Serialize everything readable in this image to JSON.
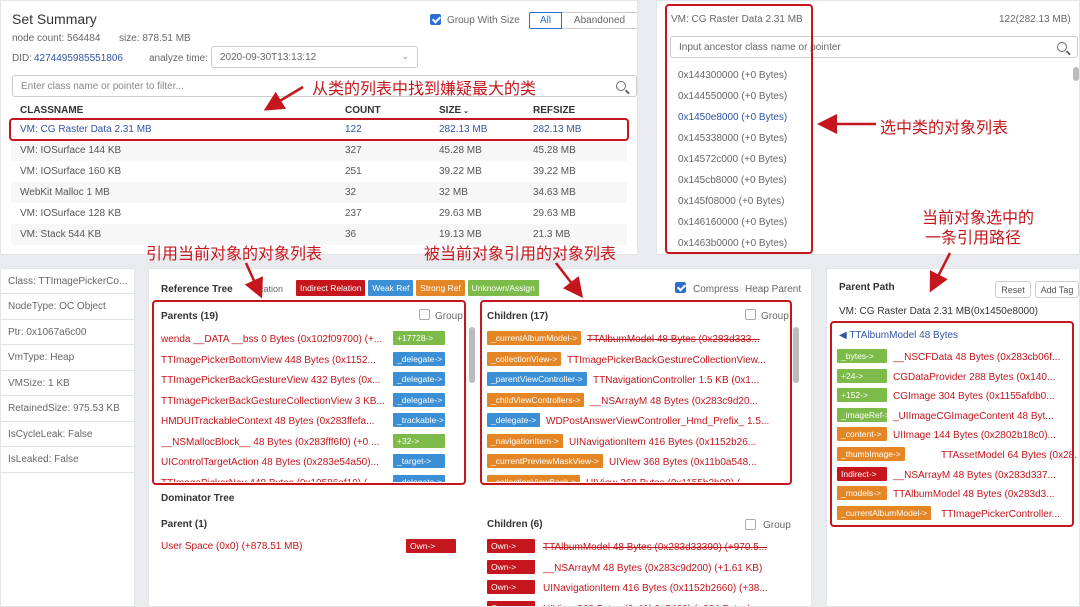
{
  "set_summary": {
    "title": "Set Summary",
    "group_with_size": "Group With Size",
    "tab_all": "All",
    "tab_abandoned": "Abandoned",
    "node_count": "node count: 564484",
    "size": "size: 878.51 MB",
    "did_label": "DID:",
    "did_value": "4274495985551806",
    "analyze_label": "analyze time:",
    "analyze_value": "2020-09-30T13:13:12",
    "filter_placeholder": "Enter class name or pointer to filter...",
    "columns": {
      "classname": "CLASSNAME",
      "count": "COUNT",
      "size": "SIZE",
      "refsize": "REFSIZE"
    },
    "rows": [
      {
        "name": "VM: CG Raster Data 2.31 MB",
        "count": "122",
        "size": "282.13 MB",
        "refsize": "282.13 MB"
      },
      {
        "name": "VM: IOSurface 144 KB",
        "count": "327",
        "size": "45.28 MB",
        "refsize": "45.28 MB"
      },
      {
        "name": "VM: IOSurface 160 KB",
        "count": "251",
        "size": "39.22 MB",
        "refsize": "39.22 MB"
      },
      {
        "name": "WebKit Malloc 1 MB",
        "count": "32",
        "size": "32 MB",
        "refsize": "34.63 MB"
      },
      {
        "name": "VM: IOSurface 128 KB",
        "count": "237",
        "size": "29.63 MB",
        "refsize": "29.63 MB"
      },
      {
        "name": "VM: Stack 544 KB",
        "count": "36",
        "size": "19.13 MB",
        "refsize": "21.3 MB"
      }
    ]
  },
  "objects": {
    "title": "VM: CG Raster Data 2.31 MB",
    "count": "122(282.13 MB)",
    "search_placeholder": "Input ancestor class name or pointer",
    "items": [
      "0x144300000 (+0 Bytes)",
      "0x144550000 (+0 Bytes)",
      "0x1450e8000 (+0 Bytes)",
      "0x145338000 (+0 Bytes)",
      "0x14572c000 (+0 Bytes)",
      "0x145cb8000 (+0 Bytes)",
      "0x145f08000 (+0 Bytes)",
      "0x146160000 (+0 Bytes)",
      "0x1463b0000 (+0 Bytes)"
    ]
  },
  "props": [
    "Class: TTImagePickerCo...",
    "NodeType: OC Object",
    "Ptr: 0x1067a6c00",
    "VmType: Heap",
    "VMSize: 1 KB",
    "RetainedSize: 975.53 KB",
    "IsCycleLeak: False",
    "IsLeaked: False"
  ],
  "reference_tree": {
    "title": "Reference Tree",
    "legend_prefix": "ication",
    "legend": [
      "Indirect Relation",
      "Weak Ref",
      "Strong Ref",
      "Unknown/Assign"
    ],
    "compress": "Compress",
    "heap_parent": "Heap Parent",
    "parents_title": "Parents (19)",
    "children_title": "Children (17)",
    "group": "Group",
    "parents": [
      {
        "text": "wenda __DATA __bss 0 Bytes (0x102f09700) (+...",
        "tag": "+17728->",
        "color": "green"
      },
      {
        "text": "TTImagePickerBottomView 448 Bytes (0x1152...",
        "tag": "_delegate->",
        "color": "blue"
      },
      {
        "text": "TTImagePickerBackGestureView 432 Bytes (0x...",
        "tag": "_delegate->",
        "color": "blue"
      },
      {
        "text": "TTImagePickerBackGestureCollectionView 3 KB...",
        "tag": "_delegate->",
        "color": "blue"
      },
      {
        "text": "HMDUITrackableContext 48 Bytes (0x283ffefa...",
        "tag": "_trackable->",
        "color": "blue"
      },
      {
        "text": "__NSMallocBlock__ 48 Bytes (0x283fff6f0) (+0 ...",
        "tag": "+32->",
        "color": "green"
      },
      {
        "text": "UIControlTargetAction 48 Bytes (0x283e54a50)...",
        "tag": "_target->",
        "color": "blue"
      },
      {
        "text": "TTImagePickerNav 448 Bytes (0x10586ef10) (",
        "tag": "_delegate->",
        "color": "blue"
      }
    ],
    "children": [
      {
        "tag": "_currentAlbumModel->",
        "color": "orange",
        "text": "TTAlbumModel 48 Bytes (0x283d333...",
        "strike": true
      },
      {
        "tag": "_collectionView->",
        "color": "orange",
        "text": "TTImagePickerBackGestureCollectionView..."
      },
      {
        "tag": "_parentViewController->",
        "color": "blue",
        "text": "TTNavigationController 1.5 KB (0x1..."
      },
      {
        "tag": "_childViewControllers->",
        "color": "orange",
        "text": "__NSArrayM 48 Bytes (0x283c9d20..."
      },
      {
        "tag": "_delegate->",
        "color": "blue",
        "text": "WDPostAnswerViewController_Hmd_Prefix_ 1.5..."
      },
      {
        "tag": "_navigationItem->",
        "color": "orange",
        "text": "UINavigationItem 416 Bytes (0x1152b26..."
      },
      {
        "tag": "_currentPreviewMaskView->",
        "color": "orange",
        "text": "UIView 368 Bytes (0x11b0a548..."
      },
      {
        "tag": "_collectionViewBack->",
        "color": "orange",
        "text": "UIView 368 Bytes (0x1155b2b00) (..."
      }
    ]
  },
  "dominator_tree": {
    "title": "Dominator Tree",
    "parent_title": "Parent (1)",
    "children_title": "Children (6)",
    "group": "Group",
    "parent": {
      "text": "User Space (0x0) (+878.51 MB)",
      "tag": "Own->"
    },
    "children": [
      {
        "tag": "Own->",
        "text": "TTAlbumModel 48 Bytes (0x283d33390) (+970.5...",
        "strike": true
      },
      {
        "tag": "Own->",
        "text": "__NSArrayM 48 Bytes (0x283c9d200) (+1.61 KB)"
      },
      {
        "tag": "Own->",
        "text": "UINavigationItem 416 Bytes (0x1152b2660) (+38..."
      },
      {
        "tag": "Own->",
        "text": "UIView 368 Bytes (0x11b0a5480) (+384 Bytes)"
      }
    ]
  },
  "parent_path": {
    "title": "Parent Path",
    "reset": "Reset",
    "add_tag": "Add Tag",
    "object": "VM: CG Raster Data 2.31 MB(0x1450e8000)",
    "head": "TTAlbumModel 48 Bytes",
    "items": [
      {
        "tag": "_bytes->",
        "color": "green",
        "text": "__NSCFData 48 Bytes (0x283cb06f..."
      },
      {
        "tag": "+24->",
        "color": "green",
        "text": "CGDataProvider 288 Bytes (0x140..."
      },
      {
        "tag": "+152->",
        "color": "green",
        "text": "CGImage 304 Bytes (0x1155afdb0..."
      },
      {
        "tag": "_imageRef->",
        "color": "green",
        "text": "_UIImageCGImageContent 48 Byt..."
      },
      {
        "tag": "_content->",
        "color": "orange",
        "text": "UIImage 144 Bytes (0x2802b18c0)..."
      },
      {
        "tag": "_thumbImage->",
        "color": "orange",
        "text": "TTAssetModel 64 Bytes (0x28..."
      },
      {
        "tag": "Indirect->",
        "color": "red",
        "text": "__NSArrayM 48 Bytes (0x283d337..."
      },
      {
        "tag": "_models->",
        "color": "orange",
        "text": "TTAlbumModel 48 Bytes (0x283d3..."
      },
      {
        "tag": "_currentAlbumModel->",
        "color": "orange",
        "text": "TTImagePickerController..."
      }
    ]
  },
  "annotations": {
    "find_class": "从类的列表中找到嫌疑最大的类",
    "object_list": "选中类的对象列表",
    "ref_path_1": "当前对象选中的",
    "ref_path_2": "一条引用路径",
    "refs_to": "引用当前对象的对象列表",
    "refs_from": "被当前对象引用的对象列表"
  }
}
